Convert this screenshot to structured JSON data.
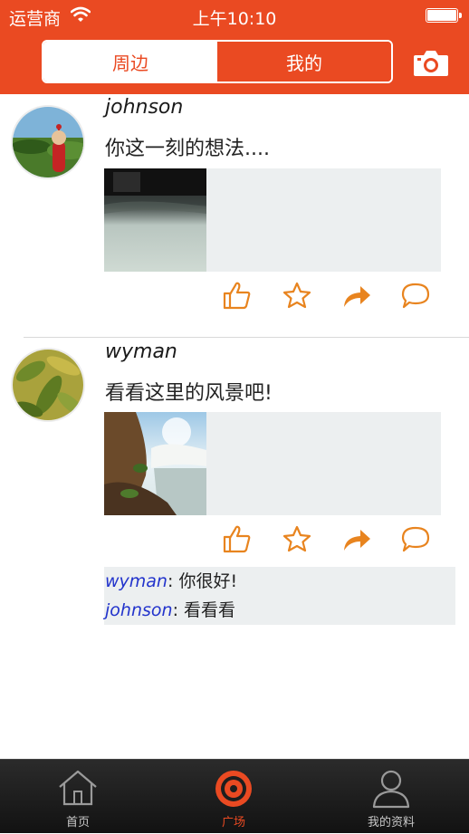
{
  "status_bar": {
    "carrier": "运营商",
    "time": "上午10:10"
  },
  "header": {
    "segments": [
      {
        "label": "周边",
        "active": true
      },
      {
        "label": "我的",
        "active": false
      }
    ],
    "camera_icon": "camera-icon"
  },
  "posts": [
    {
      "username": "johnson",
      "text": "你这一刻的想法....",
      "actions": [
        "thumbs-up-icon",
        "star-icon",
        "share-icon",
        "comment-icon"
      ]
    },
    {
      "username": "wyman",
      "text": "看看这里的风景吧!",
      "actions": [
        "thumbs-up-icon",
        "star-icon",
        "share-icon",
        "comment-icon"
      ],
      "comments": [
        {
          "user": "wyman",
          "sep": ": ",
          "text": "你很好!"
        },
        {
          "user": "johnson",
          "sep": ": ",
          "text": "看看看"
        }
      ]
    }
  ],
  "tabbar": {
    "tabs": [
      {
        "label": "首页",
        "icon": "home-icon",
        "active": false
      },
      {
        "label": "广场",
        "icon": "target-icon",
        "active": true
      },
      {
        "label": "我的资料",
        "icon": "user-icon",
        "active": false
      }
    ]
  },
  "colors": {
    "accent": "#ea4a22",
    "action_orange": "#e8841f",
    "comment_user": "#2233cc",
    "media_bg": "#eceff0"
  }
}
